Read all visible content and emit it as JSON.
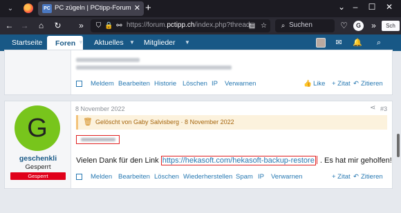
{
  "browser": {
    "tab_title": "PC zügeln | PCtipp-Forum",
    "tab_favicon": "PC",
    "url_gray_prefix": "https://forum.",
    "url_domain": "pctipp.ch",
    "url_rest": "/index.php?threads",
    "search_placeholder": "Suchen",
    "ext_label": "Sch"
  },
  "nav": {
    "items": [
      "Startseite",
      "Foren",
      "Aktuelles",
      "Mitglieder"
    ]
  },
  "post1": {
    "actions": [
      "Meldem",
      "Bearbeiten",
      "Historie",
      "Löschen",
      "IP",
      "Verwarnen"
    ],
    "right_actions": [
      "Like",
      "+ Zitat",
      "Zitieren"
    ]
  },
  "post2": {
    "avatar_letter": "G",
    "username": "geschenkli",
    "user_title": "Gesperrt",
    "banner": "Gesperrt",
    "date": "8 November 2022",
    "number": "#3",
    "deleted_notice": "Gelöscht von Gaby Salvisberg · 8 November 2022",
    "text_before": "Vielen Dank für den Link ",
    "link": "https://hekasoft.com/hekasoft-backup-restore",
    "text_after": ". Es hat mir geholfen!",
    "actions": [
      "Melden",
      "Bearbeiten",
      "Löschen",
      "Wiederherstellen",
      "Spam",
      "IP",
      "Verwarnen"
    ],
    "right_actions": [
      "+ Zitat",
      "Zitieren"
    ]
  },
  "colors": {
    "nav_bg": "#185886",
    "link": "#2577b1",
    "avatar_green": "#78c51c",
    "banner_red": "#e0001a",
    "deleted_bg": "#fcf2dd"
  }
}
